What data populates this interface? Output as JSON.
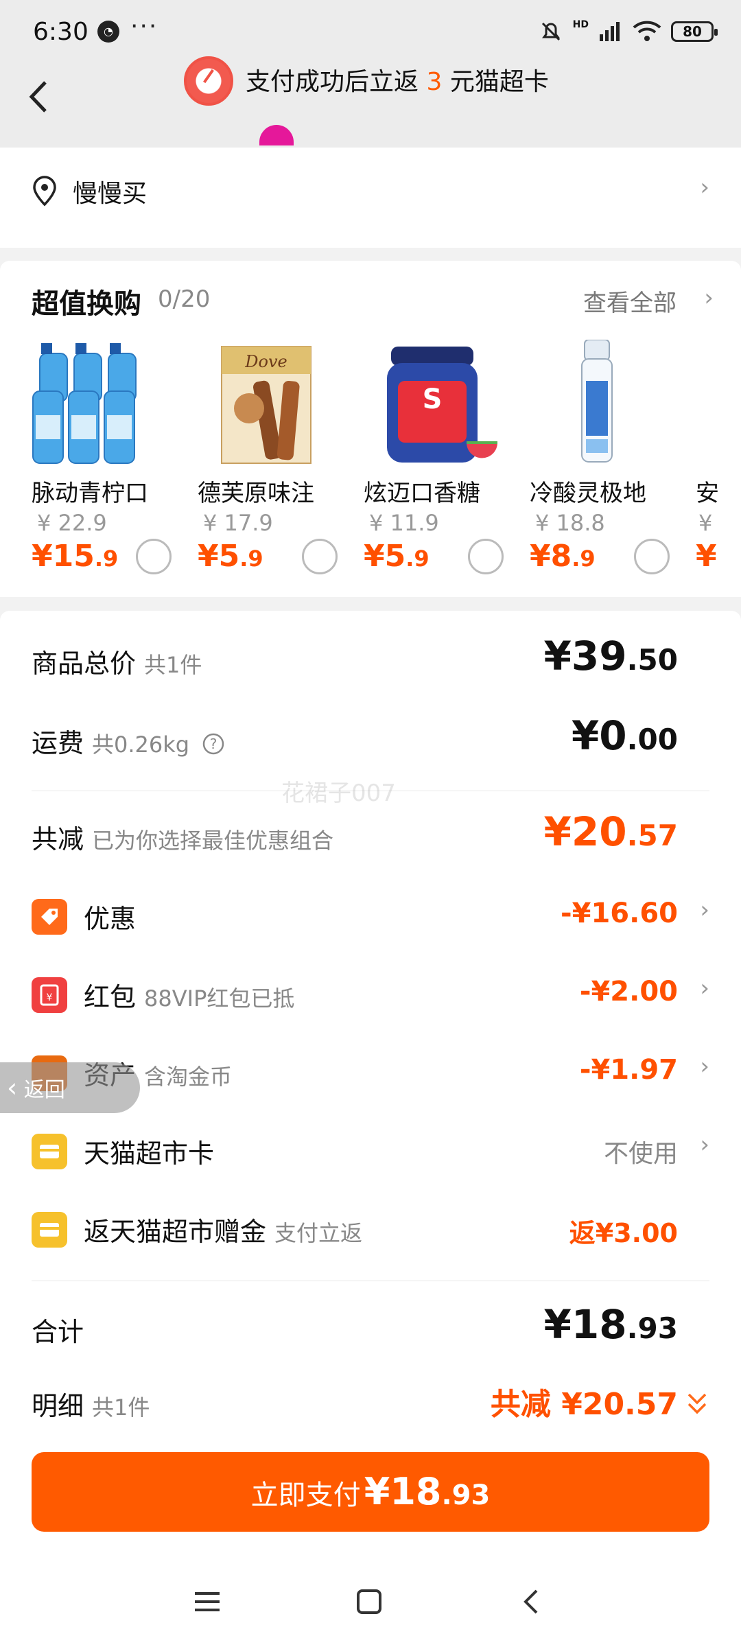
{
  "status_bar": {
    "time": "6:30",
    "battery": "80",
    "signal_label": "HD"
  },
  "header": {
    "promo_prefix": "支付成功后立返",
    "promo_number": "3",
    "promo_suffix": "元猫超卡"
  },
  "address": {
    "name": "慢慢买"
  },
  "exchange": {
    "title": "超值换购",
    "count": "0/20",
    "view_all": "查看全部",
    "products": [
      {
        "name": "脉动青柠口",
        "orig_price": "¥ 22.9",
        "price_int": "¥15",
        "price_dec": ".9"
      },
      {
        "name": "德芙原味注",
        "orig_price": "¥ 17.9",
        "price_int": "¥5",
        "price_dec": ".9"
      },
      {
        "name": "炫迈口香糖",
        "orig_price": "¥ 11.9",
        "price_int": "¥5",
        "price_dec": ".9"
      },
      {
        "name": "冷酸灵极地",
        "orig_price": "¥ 18.8",
        "price_int": "¥8",
        "price_dec": ".9"
      },
      {
        "name": "安",
        "orig_price": "¥",
        "price_int": "¥",
        "price_dec": ""
      }
    ]
  },
  "summary": {
    "goods_total_label": "商品总价",
    "goods_total_sub": "共1件",
    "goods_total_int": "¥39",
    "goods_total_dec": ".50",
    "freight_label": "运费",
    "freight_sub": "共0.26kg",
    "freight_int": "¥0",
    "freight_dec": ".00",
    "discount_label": "共减",
    "discount_sub": "已为你选择最佳优惠组合",
    "discount_int": "¥20",
    "discount_dec": ".57",
    "items": [
      {
        "label": "优惠",
        "sub": "",
        "value": "-¥16.60",
        "color": "#ff6a1a"
      },
      {
        "label": "红包",
        "sub": "88VIP红包已抵",
        "value": "-¥2.00",
        "color": "#f04040"
      },
      {
        "label": "资产",
        "sub": "含淘金币",
        "value": "-¥1.97",
        "color": "#e86a10"
      },
      {
        "label": "天猫超市卡",
        "sub": "",
        "value": "不使用",
        "color": "#f6c12c"
      },
      {
        "label": "返天猫超市赠金",
        "sub": "支付立返",
        "value": "返¥3.00",
        "color": "#f6c12c"
      }
    ],
    "total_label": "合计",
    "total_int": "¥18",
    "total_dec": ".93",
    "detail_label": "明细",
    "detail_sub": "共1件",
    "detail_value": "共减 ¥20.57"
  },
  "side_back": "返回",
  "pay_button": {
    "label": "立即支付",
    "int": "¥18",
    "dec": ".93"
  },
  "watermark": "花裙子007"
}
